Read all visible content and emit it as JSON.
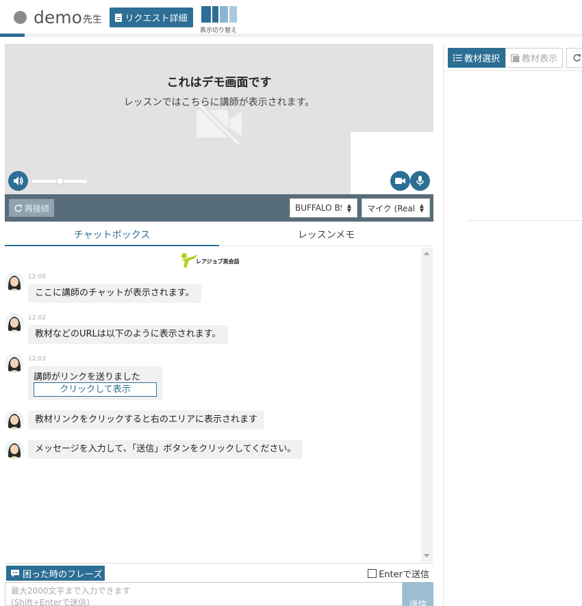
{
  "header": {
    "teacher_name": "demo",
    "teacher_suffix": "先生",
    "request_button": "リクエスト詳細",
    "layout_switch_label": "表示切り替え"
  },
  "video": {
    "title": "これはデモ画面です",
    "subtitle": "レッスンではこちらに講師が表示されます。",
    "volume_level": 0.5,
    "icons": [
      "camera-off-icon",
      "speaker-icon",
      "video-camera-icon",
      "microphone-icon"
    ]
  },
  "controls": {
    "reconnect_label": "再接続",
    "camera_select": "BUFFALO BSW",
    "mic_select": "マイク (Realtek"
  },
  "tabs": {
    "chat": "チャットボックス",
    "memo": "レッスンメモ"
  },
  "chat": {
    "logo_text": "レアジョブ英会話",
    "messages": [
      {
        "time": "12:00",
        "text": "ここに講師のチャットが表示されます。"
      },
      {
        "time": "12:02",
        "text": "教材などのURLは以下のように表示されます。"
      },
      {
        "time": "12:03",
        "text": "講師がリンクを送りました",
        "link_label": "クリックして表示"
      },
      {
        "time": "",
        "text": "教材リンクをクリックすると右のエリアに表示されます"
      },
      {
        "time": "",
        "text": "メッセージを入力して、「送信」ボタンをクリックしてください。"
      }
    ]
  },
  "composer": {
    "phrase_button": "困った時のフレーズ",
    "enter_send_label": "Enterで送信",
    "placeholder_line1": "最大2000文字まで入力できます",
    "placeholder_line2": "(Shift+Enterで送信)",
    "send_label": "送信"
  },
  "right_panel": {
    "select_material": "教材選択",
    "show_material": "教材表示"
  },
  "colors": {
    "primary": "#2c6e94",
    "control_bar": "#586d7a",
    "logo_green": "#b6cf22"
  }
}
